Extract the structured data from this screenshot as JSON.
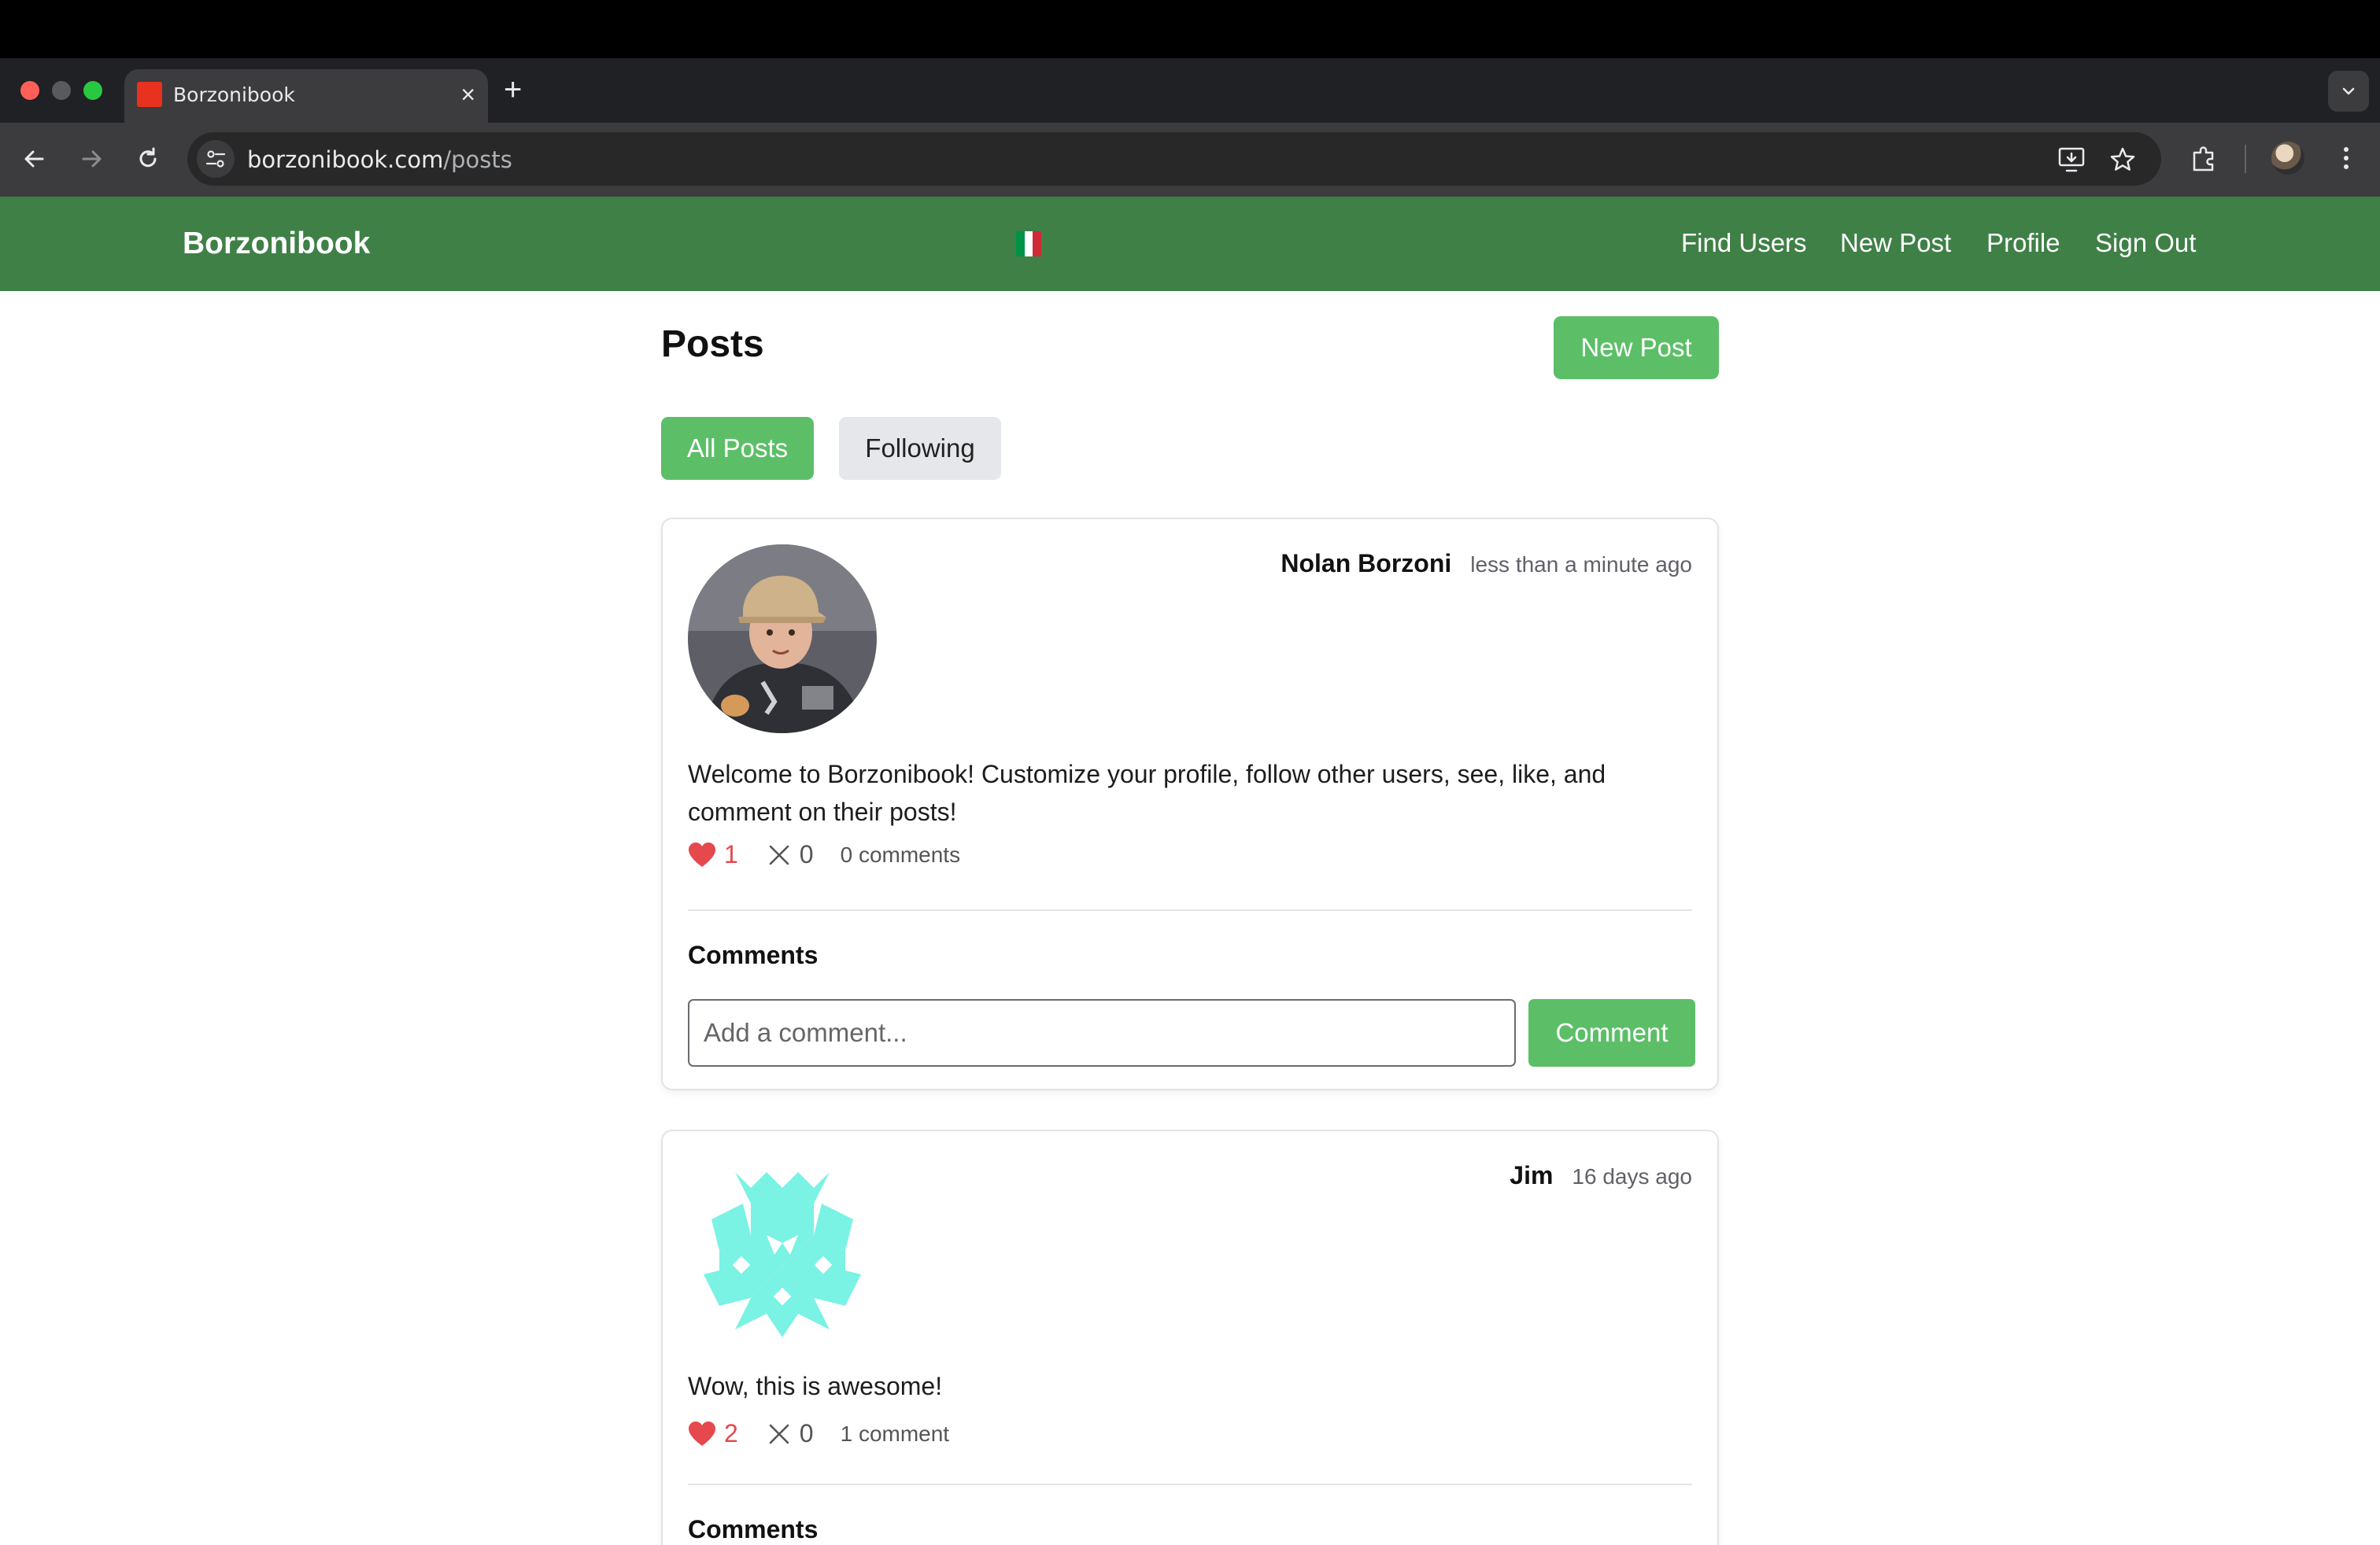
{
  "browser": {
    "tab_title": "Borzonibook",
    "url_domain": "borzonibook.com",
    "url_path": "/posts",
    "favicon_color": "#e8311f"
  },
  "navbar": {
    "brand": "Borzonibook",
    "flag_colors": [
      "#009246",
      "#ffffff",
      "#ce2b37"
    ],
    "links": [
      "Find Users",
      "New Post",
      "Profile",
      "Sign Out"
    ],
    "background": "#3f8047"
  },
  "page": {
    "title": "Posts",
    "new_post_button": "New Post",
    "filter_tabs": {
      "all": "All Posts",
      "following": "Following",
      "active": "All Posts"
    },
    "accent": "#5cbf68"
  },
  "posts": [
    {
      "author": "Nolan Borzoni",
      "time_ago": "less than a minute ago",
      "avatar": "photo-avatar",
      "text": "Welcome to Borzonibook! Customize your profile, follow other users, see, like, and comment on their posts!",
      "likes": "1",
      "dislikes": "0",
      "comment_count": "0 comments",
      "comments_heading": "Comments",
      "comment_placeholder": "Add a comment...",
      "comment_button": "Comment"
    },
    {
      "author": "Jim",
      "time_ago": "16 days ago",
      "avatar": "identicon-avatar",
      "identicon_color": "#7af2e4",
      "text": "Wow, this is awesome!",
      "likes": "2",
      "dislikes": "0",
      "comment_count": "1 comment",
      "comments_heading": "Comments"
    }
  ]
}
